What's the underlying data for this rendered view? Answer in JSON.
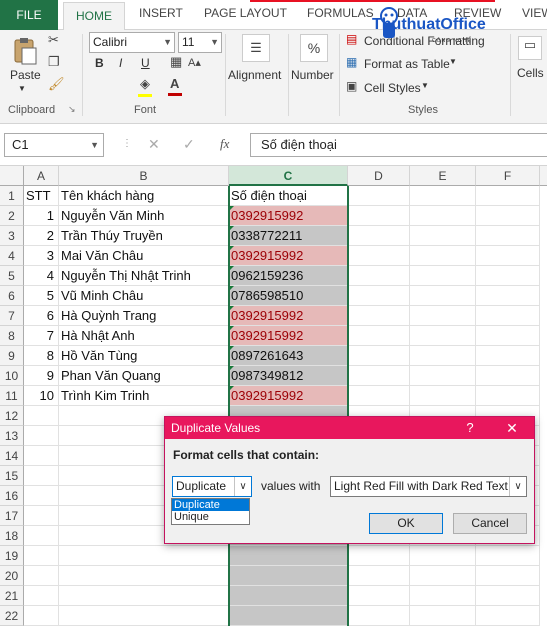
{
  "tabs": [
    "FILE",
    "HOME",
    "INSERT",
    "PAGE LAYOUT",
    "FORMULAS",
    "DATA",
    "REVIEW",
    "VIEW"
  ],
  "ribbon": {
    "clipboard": {
      "paste": "Paste",
      "group": "Clipboard"
    },
    "font": {
      "name": "Calibri",
      "size": "11",
      "group": "Font",
      "bold": "B",
      "italic": "I",
      "underline": "U",
      "fill_color": "#ffff00",
      "font_color": "#c00000"
    },
    "alignment": "Alignment",
    "number": {
      "label": "Number",
      "symbol": "%"
    },
    "styles": {
      "conditional": "Conditional Formatting",
      "as_table": "Format as Table",
      "cell_styles": "Cell Styles",
      "group": "Styles"
    },
    "cells": "Cells"
  },
  "logo": {
    "text": "ThuthuatOffice",
    "sub": "CÔNG NGHỆ"
  },
  "formula_bar": {
    "name_box": "C1",
    "fx": "fx",
    "content": "Số điện thoại"
  },
  "columns": [
    "A",
    "B",
    "C",
    "D",
    "E",
    "F"
  ],
  "rows": [
    {
      "num": "1",
      "a": "STT",
      "b": "Tên khách hàng",
      "c": "Số điện thoại",
      "dup": false
    },
    {
      "num": "2",
      "a": "1",
      "b": "Nguyễn Văn Minh",
      "c": "0392915992",
      "dup": true
    },
    {
      "num": "3",
      "a": "2",
      "b": "Trần Thúy Truyền",
      "c": "0338772211",
      "dup": false
    },
    {
      "num": "4",
      "a": "3",
      "b": "Mai Văn Châu",
      "c": "0392915992",
      "dup": true
    },
    {
      "num": "5",
      "a": "4",
      "b": "Nguyễn Thị Nhật Trinh",
      "c": "0962159236",
      "dup": false
    },
    {
      "num": "6",
      "a": "5",
      "b": "Vũ Minh Châu",
      "c": "0786598510",
      "dup": false
    },
    {
      "num": "7",
      "a": "6",
      "b": "Hà Quỳnh Trang",
      "c": "0392915992",
      "dup": true
    },
    {
      "num": "8",
      "a": "7",
      "b": "Hà Nhật Anh",
      "c": "0392915992",
      "dup": true
    },
    {
      "num": "9",
      "a": "8",
      "b": "Hồ Văn Tùng",
      "c": "0897261643",
      "dup": false
    },
    {
      "num": "10",
      "a": "9",
      "b": "Phan Văn Quang",
      "c": "0987349812",
      "dup": false
    },
    {
      "num": "11",
      "a": "10",
      "b": "Trình Kim Trinh",
      "c": "0392915992",
      "dup": true
    },
    {
      "num": "12"
    },
    {
      "num": "13"
    },
    {
      "num": "14"
    },
    {
      "num": "15"
    },
    {
      "num": "16"
    },
    {
      "num": "17"
    },
    {
      "num": "18"
    },
    {
      "num": "19"
    },
    {
      "num": "20"
    },
    {
      "num": "21"
    },
    {
      "num": "22"
    }
  ],
  "colors": {
    "dup_fill": "#e6b9b8",
    "dup_text": "#9c0006",
    "excel_green": "#217346",
    "dialog_title": "#e8175d"
  },
  "dialog": {
    "title": "Duplicate Values",
    "help": "?",
    "close": "✕",
    "prompt": "Format cells that contain:",
    "type_value": "Duplicate",
    "type_options": [
      "Duplicate",
      "Unique"
    ],
    "values_with": "values with",
    "format_value": "Light Red Fill with Dark Red Text",
    "ok": "OK",
    "cancel": "Cancel"
  }
}
